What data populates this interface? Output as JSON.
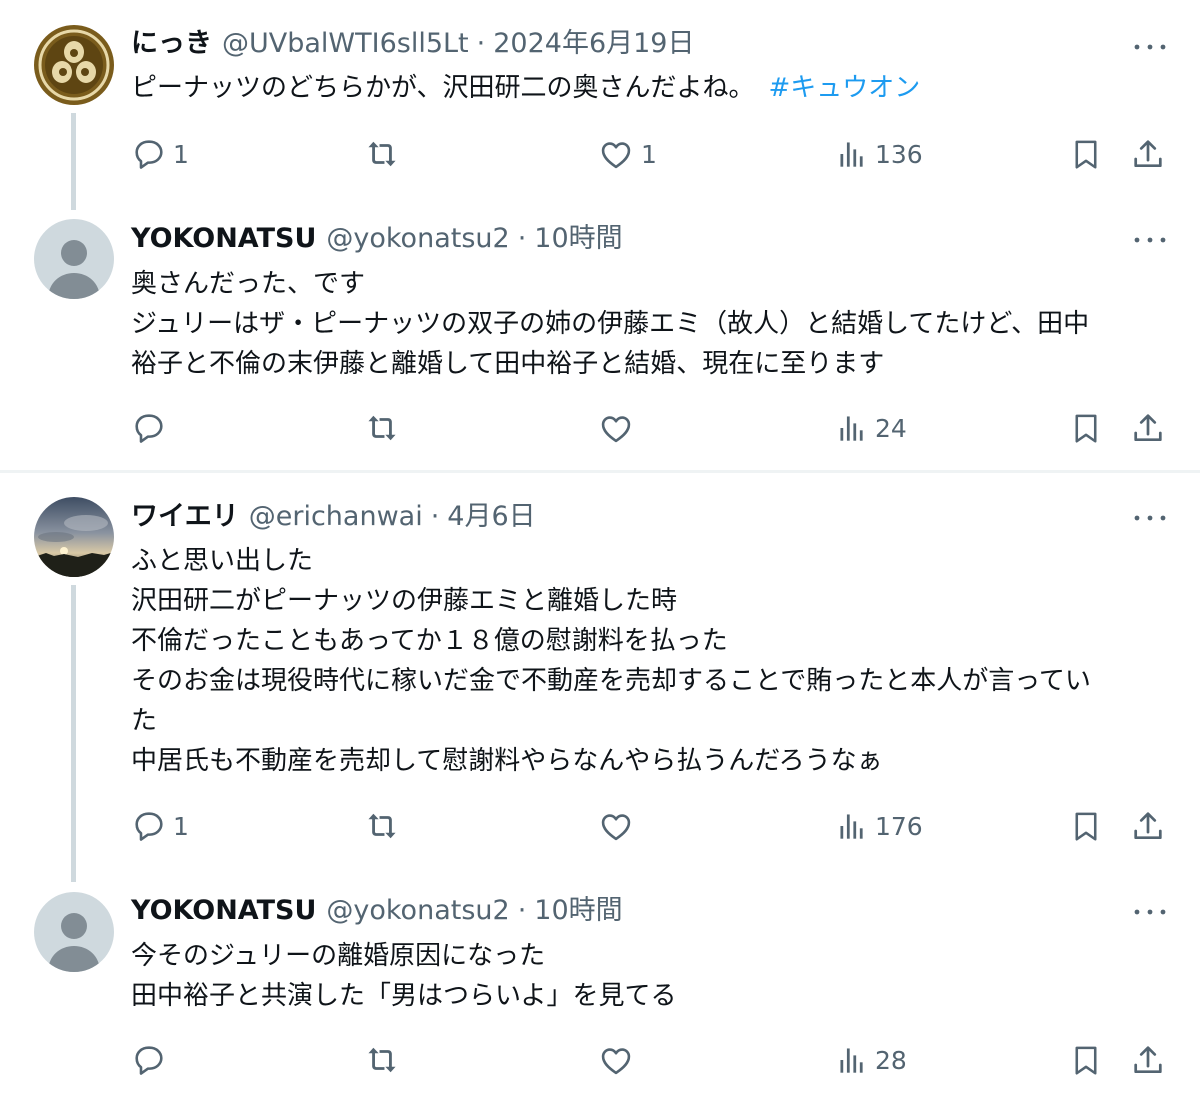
{
  "tweets": [
    {
      "name": "にっき",
      "handle": "@UVbalWTI6sll5Lt",
      "separator": "·",
      "time": "2024年6月19日",
      "lines": [
        "ピーナッツのどちらかが、沢田研二の奥さんだよね。"
      ],
      "hashtag": "#キュウオン",
      "replies": "1",
      "retweets": "",
      "likes": "1",
      "views": "136"
    },
    {
      "name": "YOKONATSU",
      "handle": "@yokonatsu2",
      "separator": "·",
      "time": "10時間",
      "lines": [
        "奥さんだった、です",
        "ジュリーはザ・ピーナッツの双子の姉の伊藤エミ（故人）と結婚してたけど、田中",
        "裕子と不倫の末伊藤と離婚して田中裕子と結婚、現在に至ります"
      ],
      "replies": "",
      "retweets": "",
      "likes": "",
      "views": "24"
    },
    {
      "name": "ワイエリ",
      "handle": "@erichanwai",
      "separator": "·",
      "time": "4月6日",
      "lines": [
        "ふと思い出した",
        "沢田研二がピーナッツの伊藤エミと離婚した時",
        "不倫だったこともあってか１８億の慰謝料を払った",
        "そのお金は現役時代に稼いだ金で不動産を売却することで賄ったと本人が言ってい",
        "た",
        "中居氏も不動産を売却して慰謝料やらなんやら払うんだろうなぁ"
      ],
      "replies": "1",
      "retweets": "",
      "likes": "",
      "views": "176"
    },
    {
      "name": "YOKONATSU",
      "handle": "@yokonatsu2",
      "separator": "·",
      "time": "10時間",
      "lines": [
        "今そのジュリーの離婚原因になった",
        "田中裕子と共演した「男はつらいよ」を見てる"
      ],
      "replies": "",
      "retweets": "",
      "likes": "",
      "views": "28"
    }
  ],
  "colors": {
    "text": "#0f1419",
    "secondary": "#536471",
    "link": "#1d9bf0",
    "thread_line": "#cfd9de",
    "divider": "#eff3f4",
    "crest_bg": "#7a5c1c",
    "crest_fg": "#e7d8a8"
  },
  "icons": {
    "reply": "reply-icon",
    "retweet": "retweet-icon",
    "like": "heart-icon",
    "views": "views-icon",
    "bookmark": "bookmark-icon",
    "share": "share-icon",
    "more": "more-icon"
  }
}
